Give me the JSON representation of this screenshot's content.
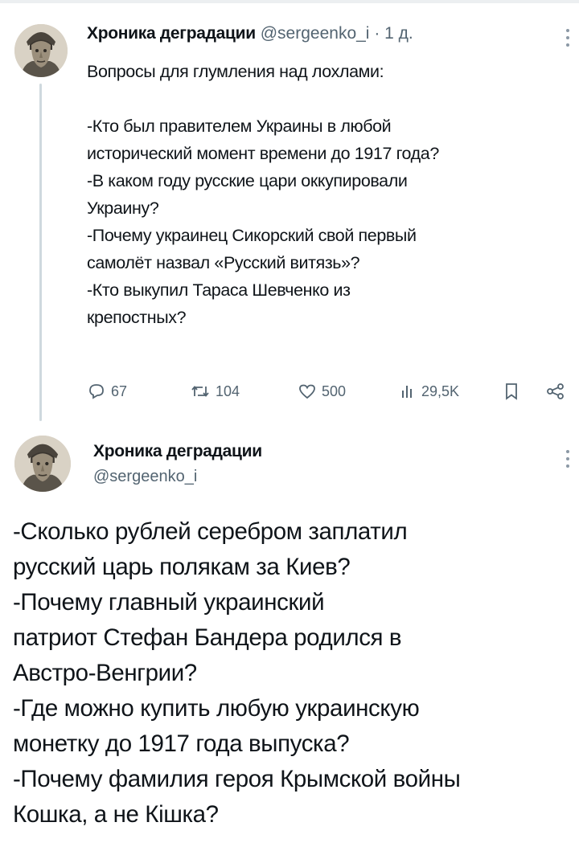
{
  "tweet1": {
    "author_name": "Хроника деградации",
    "handle": "@sergeenko_i",
    "separator": "·",
    "time": "1 д.",
    "lines": [
      "Вопросы для глумления над лохлами:",
      "",
      "-Кто был правителем Украины в любой",
      "исторический момент времени до 1917 года?",
      "-В каком году русские цари оккупировали",
      "Украину?",
      "-Почему украинец Сикорский свой первый",
      "самолёт назвал «Русский витязь»?",
      "-Кто выкупил Тараса Шевченко из",
      "крепостных?"
    ],
    "actions": {
      "replies": "67",
      "retweets": "104",
      "likes": "500",
      "views": "29,5K"
    }
  },
  "tweet2": {
    "author_name": "Хроника деградации",
    "handle": "@sergeenko_i",
    "lines": [
      "-Сколько рублей серебром заплатил",
      "русский царь полякам за Киев?",
      "-Почему главный украинский",
      "патриот Стефан Бандера родился в",
      "Австро-Венгрии?",
      "-Где можно купить любую украинскую",
      "монетку до 1917 года выпуска?",
      "-Почему фамилия героя Крымской войны",
      "Кошка, а не Кішка?"
    ]
  },
  "icons": {
    "reply": "reply-icon",
    "retweet": "retweet-icon",
    "like": "like-icon",
    "views": "views-icon",
    "bookmark": "bookmark-icon",
    "share": "share-icon",
    "more": "more-icon"
  },
  "colors": {
    "text": "#0f1419",
    "secondary": "#536471",
    "thread_line": "#cfd9de"
  }
}
